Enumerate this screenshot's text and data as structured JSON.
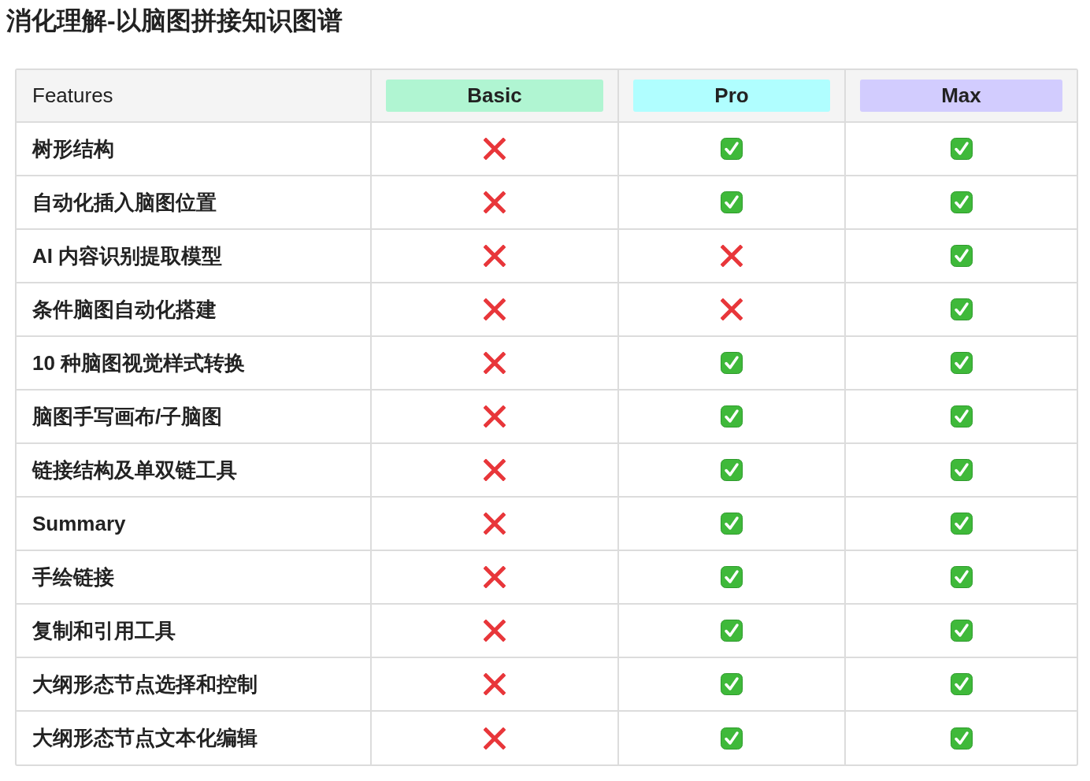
{
  "title": "消化理解-以脑图拼接知识图谱",
  "table": {
    "feature_heading": "Features",
    "plans": [
      {
        "name": "Basic",
        "color": "#b0f5d2"
      },
      {
        "name": "Pro",
        "color": "#b0feff"
      },
      {
        "name": "Max",
        "color": "#d2ccfe"
      }
    ],
    "rows": [
      {
        "feature": "树形结构",
        "included": [
          false,
          true,
          true
        ]
      },
      {
        "feature": "自动化插入脑图位置",
        "included": [
          false,
          true,
          true
        ]
      },
      {
        "feature": "AI 内容识别提取模型",
        "included": [
          false,
          false,
          true
        ]
      },
      {
        "feature": "条件脑图自动化搭建",
        "included": [
          false,
          false,
          true
        ]
      },
      {
        "feature": "10 种脑图视觉样式转换",
        "included": [
          false,
          true,
          true
        ]
      },
      {
        "feature": "脑图手写画布/子脑图",
        "included": [
          false,
          true,
          true
        ]
      },
      {
        "feature": "链接结构及单双链工具",
        "included": [
          false,
          true,
          true
        ]
      },
      {
        "feature": "Summary",
        "included": [
          false,
          true,
          true
        ]
      },
      {
        "feature": "手绘链接",
        "included": [
          false,
          true,
          true
        ]
      },
      {
        "feature": "复制和引用工具",
        "included": [
          false,
          true,
          true
        ]
      },
      {
        "feature": "大纲形态节点选择和控制",
        "included": [
          false,
          true,
          true
        ]
      },
      {
        "feature": "大纲形态节点文本化编辑",
        "included": [
          false,
          true,
          true
        ]
      }
    ]
  }
}
